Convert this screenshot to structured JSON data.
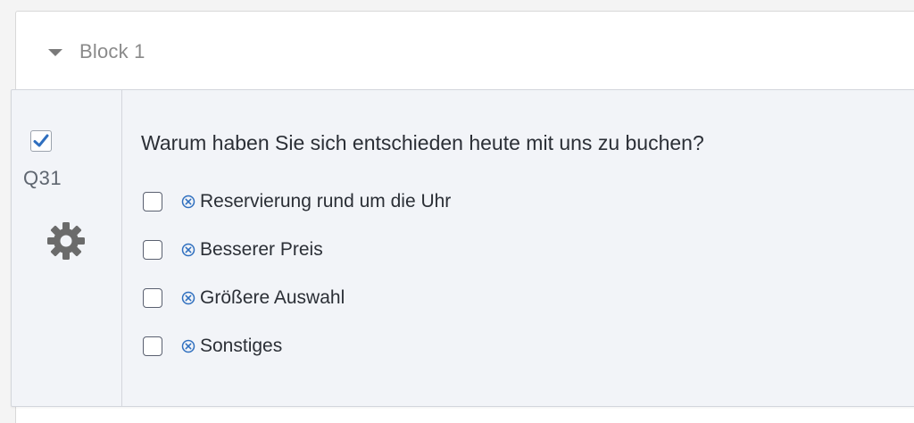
{
  "block": {
    "title": "Block 1"
  },
  "question": {
    "id": "Q31",
    "selected": true,
    "text": "Warum haben Sie sich entschieden heute mit uns zu buchen?",
    "choices": [
      {
        "label": "Reservierung rund um die Uhr"
      },
      {
        "label": "Besserer Preis"
      },
      {
        "label": "Größere Auswahl"
      },
      {
        "label": "Sonstiges"
      }
    ]
  },
  "icons": {
    "collapse": "caret-down-icon",
    "select": "checkmark-icon",
    "settings": "gear-icon",
    "remove_choice": "circle-x-icon"
  },
  "colors": {
    "accent_blue": "#2f6fbf",
    "gear_gray": "#6b6b6b"
  }
}
